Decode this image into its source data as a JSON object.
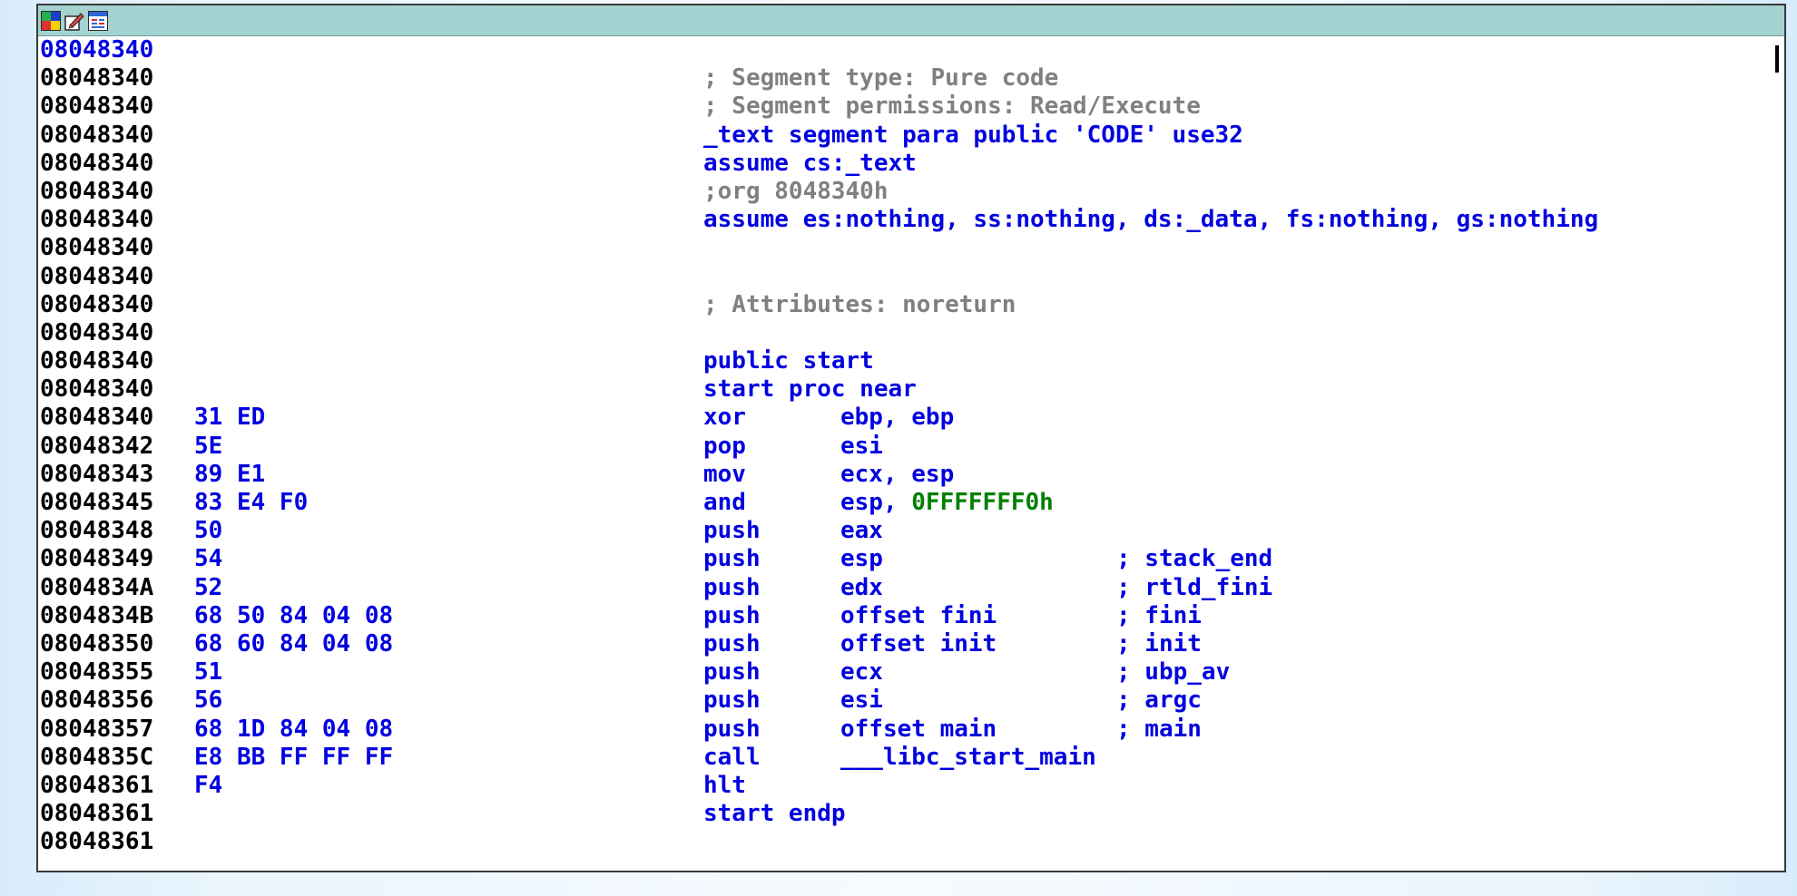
{
  "toolbar": {
    "icons": [
      "graph-view-icon",
      "edit-icon",
      "hex-view-icon"
    ]
  },
  "listing": [
    {
      "addr": "08048340",
      "current": true,
      "bytes": "",
      "code": "",
      "kind": "blank"
    },
    {
      "addr": "08048340",
      "bytes": "",
      "code": "; Segment type: Pure code",
      "kind": "gray"
    },
    {
      "addr": "08048340",
      "bytes": "",
      "code": "; Segment permissions: Read/Execute",
      "kind": "gray"
    },
    {
      "addr": "08048340",
      "bytes": "",
      "code": "_text segment para public 'CODE' use32",
      "kind": "blue"
    },
    {
      "addr": "08048340",
      "bytes": "",
      "code": "assume cs:_text",
      "kind": "blue"
    },
    {
      "addr": "08048340",
      "bytes": "",
      "code": ";org 8048340h",
      "kind": "gray"
    },
    {
      "addr": "08048340",
      "bytes": "",
      "code": "assume es:nothing, ss:nothing, ds:_data, fs:nothing, gs:nothing",
      "kind": "blue"
    },
    {
      "addr": "08048340",
      "bytes": "",
      "code": "",
      "kind": "blank"
    },
    {
      "addr": "08048340",
      "bytes": "",
      "code": "",
      "kind": "blank"
    },
    {
      "addr": "08048340",
      "bytes": "",
      "code": "; Attributes: noreturn",
      "kind": "gray"
    },
    {
      "addr": "08048340",
      "bytes": "",
      "code": "",
      "kind": "blank"
    },
    {
      "addr": "08048340",
      "bytes": "",
      "code": "public start",
      "kind": "blue"
    },
    {
      "addr": "08048340",
      "bytes": "",
      "code": "start proc near",
      "kind": "blue"
    },
    {
      "addr": "08048340",
      "bytes": "31 ED",
      "mnem": "xor",
      "oper": "ebp, ebp",
      "kind": "insn"
    },
    {
      "addr": "08048342",
      "bytes": "5E",
      "mnem": "pop",
      "oper": "esi",
      "kind": "insn"
    },
    {
      "addr": "08048343",
      "bytes": "89 E1",
      "mnem": "mov",
      "oper": "ecx, esp",
      "kind": "insn"
    },
    {
      "addr": "08048345",
      "bytes": "83 E4 F0",
      "mnem": "and",
      "oper": "esp, ",
      "imm": "0FFFFFFF0h",
      "kind": "insn"
    },
    {
      "addr": "08048348",
      "bytes": "50",
      "mnem": "push",
      "oper": "eax",
      "kind": "insn"
    },
    {
      "addr": "08048349",
      "bytes": "54",
      "mnem": "push",
      "oper": "esp",
      "cmt": "; stack_end",
      "kind": "insn"
    },
    {
      "addr": "0804834A",
      "bytes": "52",
      "mnem": "push",
      "oper": "edx",
      "cmt": "; rtld_fini",
      "kind": "insn"
    },
    {
      "addr": "0804834B",
      "bytes": "68 50 84 04 08",
      "mnem": "push",
      "oper": "offset fini",
      "cmt": "; fini",
      "kind": "insn"
    },
    {
      "addr": "08048350",
      "bytes": "68 60 84 04 08",
      "mnem": "push",
      "oper": "offset init",
      "cmt": "; init",
      "kind": "insn"
    },
    {
      "addr": "08048355",
      "bytes": "51",
      "mnem": "push",
      "oper": "ecx",
      "cmt": "; ubp_av",
      "kind": "insn"
    },
    {
      "addr": "08048356",
      "bytes": "56",
      "mnem": "push",
      "oper": "esi",
      "cmt": "; argc",
      "kind": "insn"
    },
    {
      "addr": "08048357",
      "bytes": "68 1D 84 04 08",
      "mnem": "push",
      "oper": "offset main",
      "cmt": "; main",
      "kind": "insn"
    },
    {
      "addr": "0804835C",
      "bytes": "E8 BB FF FF FF",
      "mnem": "call",
      "oper": "___libc_start_main",
      "kind": "insn"
    },
    {
      "addr": "08048361",
      "bytes": "F4",
      "mnem": "hlt",
      "oper": "",
      "kind": "insn"
    },
    {
      "addr": "08048361",
      "bytes": "",
      "code": "start endp",
      "kind": "blue"
    },
    {
      "addr": "08048361",
      "bytes": "",
      "code": "",
      "kind": "blank"
    }
  ]
}
